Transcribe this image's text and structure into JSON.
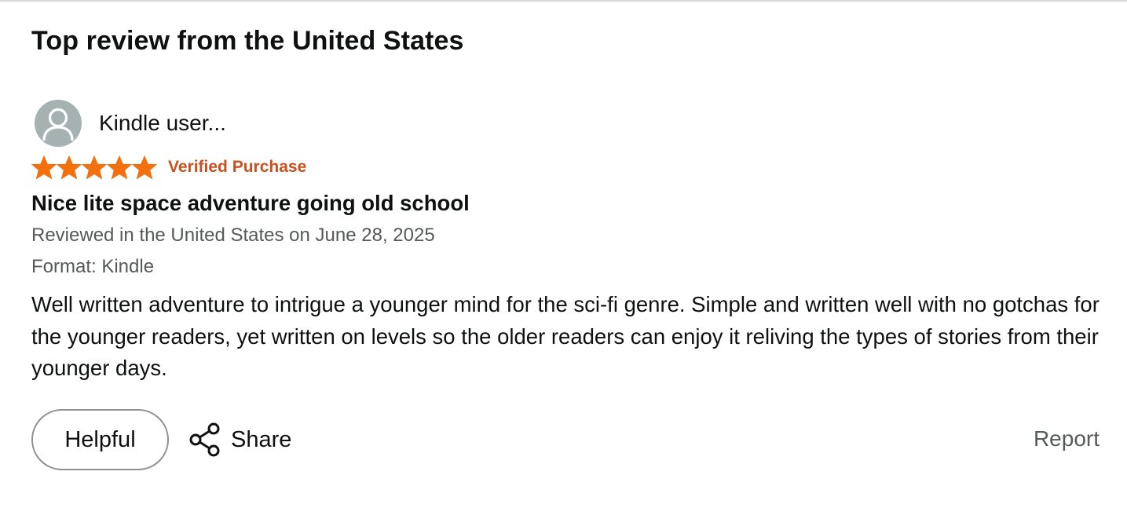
{
  "section": {
    "heading": "Top review from the United States"
  },
  "review": {
    "profile_name": "Kindle user...",
    "rating": 5,
    "rating_max": 5,
    "star_color": "#f3700f",
    "verified_label": "Verified Purchase",
    "verified_color": "#c7511f",
    "title": "Nice lite space adventure going old school",
    "date_line": "Reviewed in the United States on June 28, 2025",
    "format_line": "Format: Kindle",
    "body": "Well written adventure to intrigue a younger mind for the sci-fi genre. Simple and written well with no gotchas for the younger readers, yet written on levels so the older readers can enjoy it reliving the types of stories from their younger days."
  },
  "actions": {
    "helpful_label": "Helpful",
    "share_label": "Share",
    "report_label": "Report"
  },
  "icons": {
    "avatar": "person-silhouette-icon",
    "share": "share-icon",
    "star": "star-icon"
  }
}
